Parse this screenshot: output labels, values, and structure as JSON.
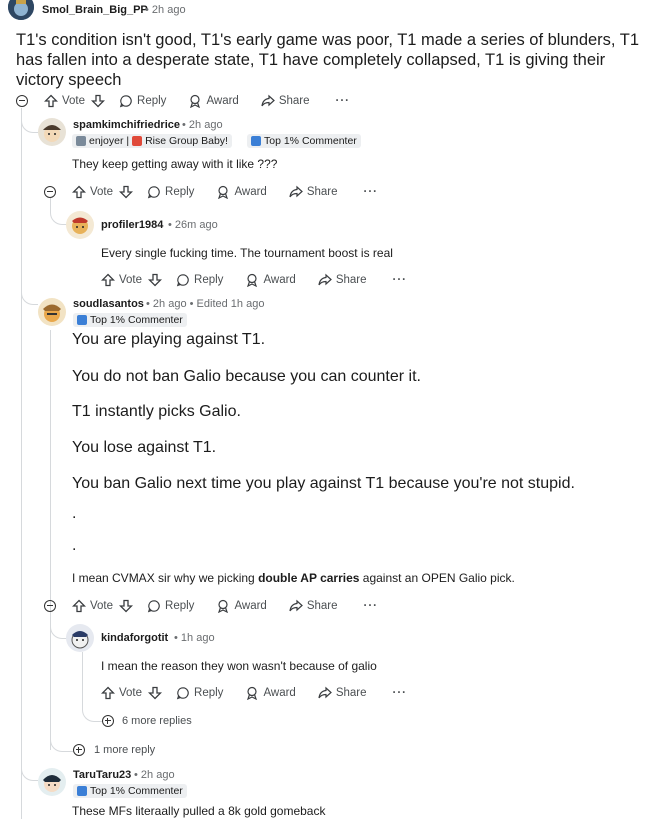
{
  "top_comment": {
    "username": "Smol_Brain_Big_PP",
    "time": "2h ago",
    "body": "T1's condition isn't good, T1's early game was poor, T1 made a series of blunders, T1 has fallen into a desperate state, T1 have completely collapsed, T1 is giving their victory speech"
  },
  "actions": {
    "vote": "Vote",
    "reply": "Reply",
    "award": "Award",
    "share": "Share",
    "more": "···"
  },
  "c1": {
    "username": "spamkimchifriedrice",
    "time": "2h ago",
    "flair1": "enjoyer |",
    "flair1b": "Rise Group Baby!",
    "flair2": "Top 1% Commenter",
    "body": "They keep getting away with it like ???"
  },
  "c2": {
    "username": "profiler1984",
    "time": "26m ago",
    "body": "Every single fucking time. The tournament boost is real"
  },
  "c3": {
    "username": "soudlasantos",
    "time": "2h ago",
    "edited": "Edited 1h ago",
    "flair": "Top 1% Commenter",
    "lines": [
      "You are playing against T1.",
      "You do not ban Galio because you can counter it.",
      "T1 instantly picks Galio.",
      "You lose against T1.",
      "You ban Galio next time you play against T1 because you're not stupid.",
      ".",
      "."
    ],
    "last_pre": "I mean CVMAX sir why we picking ",
    "last_bold": "double AP carries",
    "last_post": " against an OPEN Galio pick."
  },
  "c4": {
    "username": "kindaforgotit",
    "time": "1h ago",
    "body": "I mean the reason they won wasn't because of galio",
    "more_replies": "6 more replies"
  },
  "more_reply_c3": "1 more reply",
  "c5": {
    "username": "TaruTaru23",
    "time": "2h ago",
    "flair": "Top 1% Commenter",
    "body": "These MFs literaally pulled a 8k gold gomeback"
  }
}
